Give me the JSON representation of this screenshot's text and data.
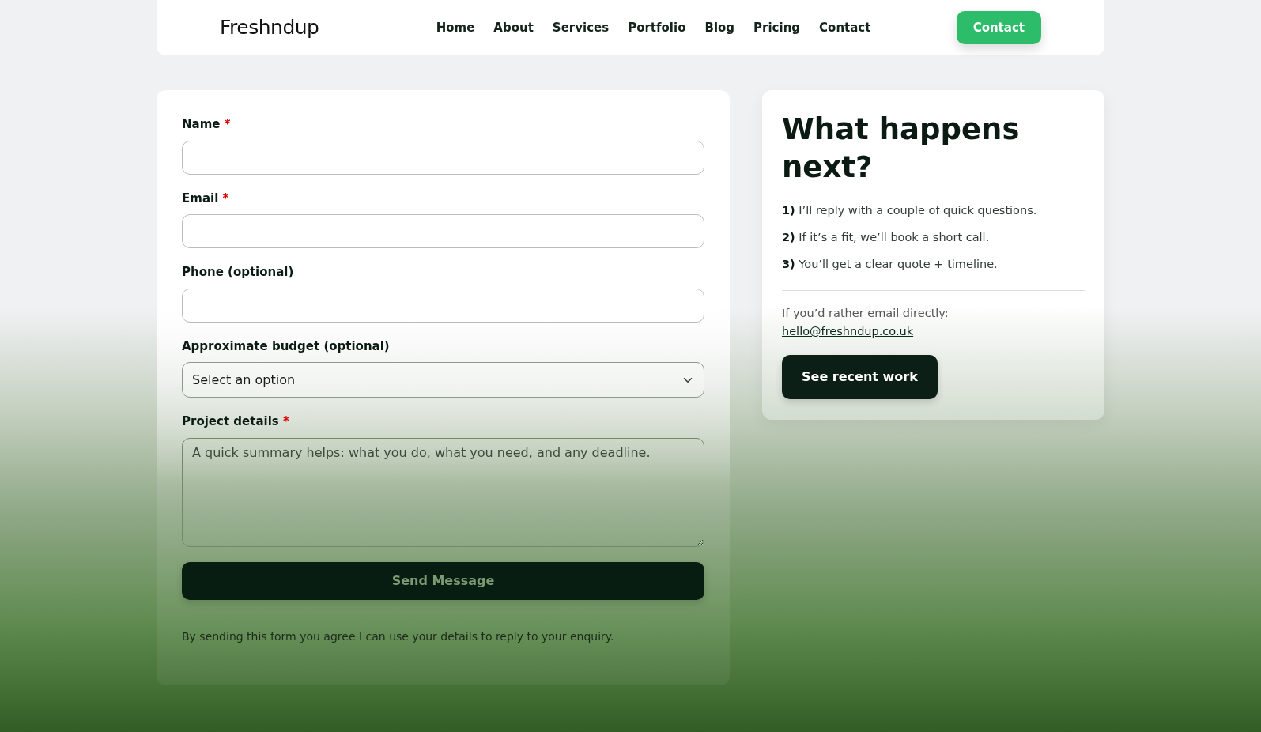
{
  "header": {
    "brand": "Freshndup",
    "nav": [
      {
        "label": "Home"
      },
      {
        "label": "About"
      },
      {
        "label": "Services"
      },
      {
        "label": "Portfolio"
      },
      {
        "label": "Blog"
      },
      {
        "label": "Pricing"
      },
      {
        "label": "Contact"
      }
    ],
    "cta": "Contact"
  },
  "form": {
    "fields": [
      {
        "kind": "input",
        "label": "Name",
        "required_mark": "*"
      },
      {
        "kind": "input",
        "label": "Email",
        "required_mark": "*"
      },
      {
        "kind": "input",
        "label": "Phone (optional)"
      },
      {
        "kind": "select",
        "label": "Approximate budget (optional)",
        "value": "Select an option"
      },
      {
        "kind": "textarea",
        "label": "Project details",
        "required_mark": "*",
        "placeholder": "A quick summary helps: what you do, what you need, and any deadline."
      }
    ],
    "submit": "Send Message",
    "note": "By sending this form you agree I can use your details to reply to your enquiry."
  },
  "next": {
    "title": "What happens next?",
    "steps": [
      "**1)** I’ll reply with a couple of quick questions.",
      "**2)** If it’s a fit, we’ll book a short call.",
      "**3)** You’ll get a clear quote + timeline."
    ],
    "email_intro": "If you’d rather email directly:",
    "email": "hello@freshndup.co.uk",
    "button": "See recent work"
  }
}
